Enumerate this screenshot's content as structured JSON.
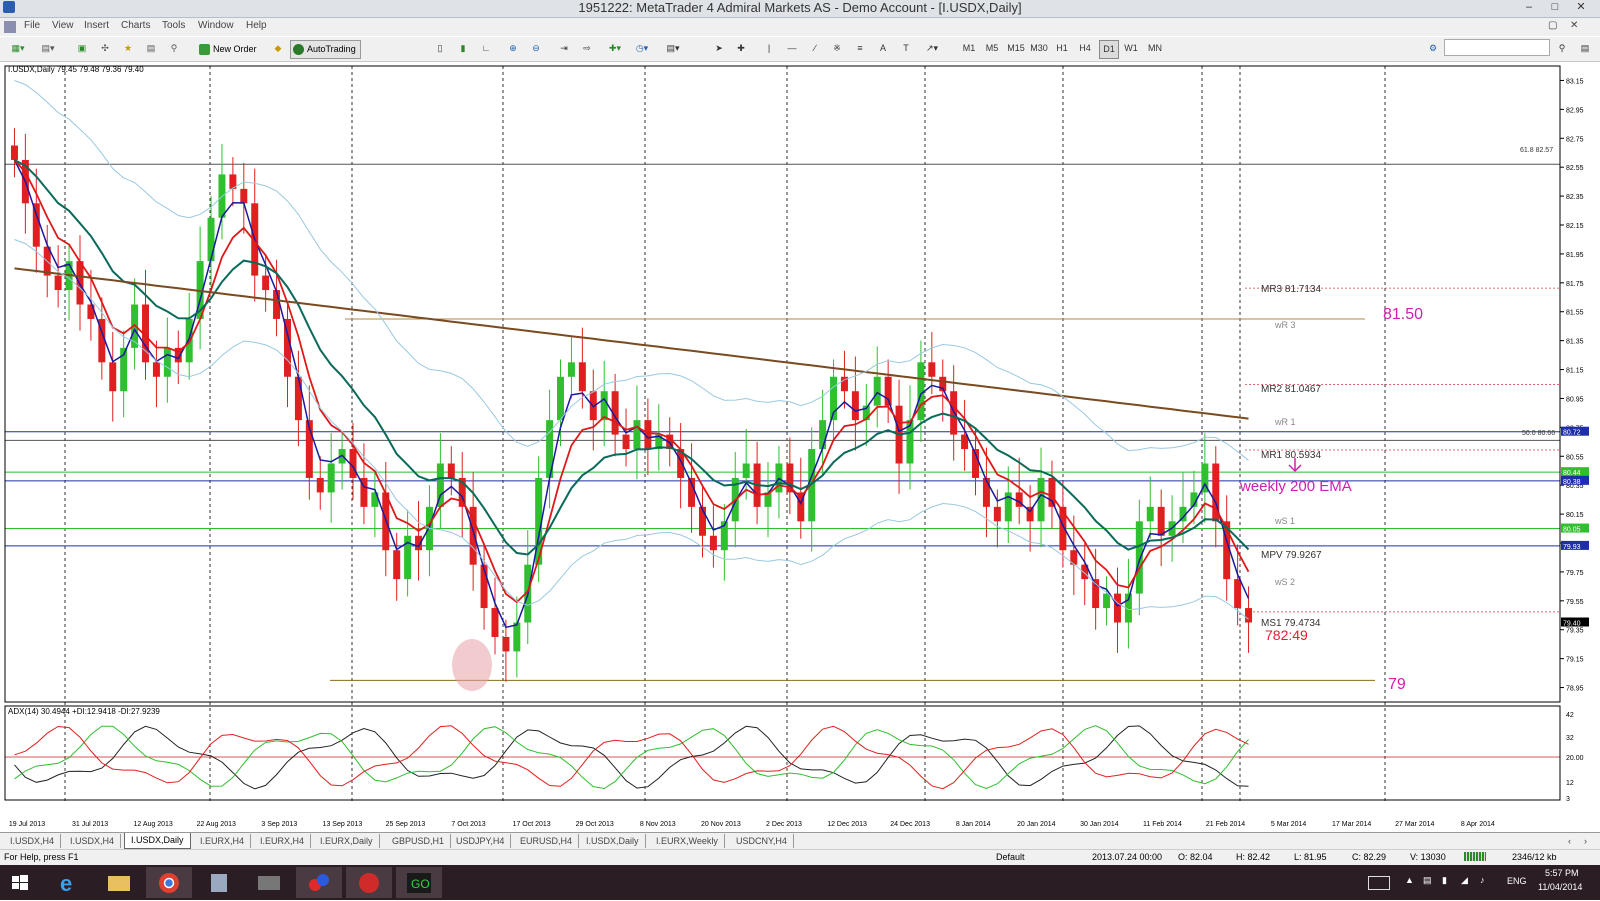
{
  "window": {
    "title": "1951222: MetaTrader 4 Admiral Markets AS - Demo Account - [I.USDX,Daily]"
  },
  "menu": [
    "File",
    "View",
    "Insert",
    "Charts",
    "Tools",
    "Window",
    "Help"
  ],
  "toolbar": {
    "new_order_label": "New Order",
    "autotrading_label": "AutoTrading",
    "timeframes": [
      "M1",
      "M5",
      "M15",
      "M30",
      "H1",
      "H4",
      "D1",
      "W1",
      "MN"
    ],
    "active_timeframe": "D1"
  },
  "chart": {
    "symbol_header": "I.USDX,Daily  79.45 79.48 79.36 79.40",
    "price_labels": [
      "83.15",
      "82.95",
      "82.75",
      "82.55",
      "82.35",
      "82.15",
      "81.95",
      "81.75",
      "81.55",
      "81.35",
      "81.15",
      "80.95",
      "80.75",
      "80.55",
      "80.35",
      "80.15",
      "79.95",
      "79.75",
      "79.55",
      "79.35",
      "79.15",
      "78.95"
    ],
    "highlighted_prices": [
      {
        "value": "80.72",
        "color": "#1f2fa8"
      },
      {
        "value": "80.44",
        "color": "#2fbf2f"
      },
      {
        "value": "80.38",
        "color": "#1f2fa8"
      },
      {
        "value": "80.05",
        "color": "#2fbf2f"
      },
      {
        "value": "79.93",
        "color": "#1f2fa8"
      },
      {
        "value": "79.40",
        "color": "#000000"
      }
    ],
    "fib_labels": [
      "61.8  82.57",
      "50.0  80.66"
    ],
    "pivots": [
      {
        "label": "MR3  81.7134"
      },
      {
        "label": "wR 3"
      },
      {
        "label": "MR2  81.0467"
      },
      {
        "label": "wR 1"
      },
      {
        "label": "MR1  80.5934"
      },
      {
        "label": "wS 1"
      },
      {
        "label": "MPV  79.9267"
      },
      {
        "label": "wS 2"
      },
      {
        "label": "MS1  79.4734"
      }
    ],
    "annotations": {
      "level_high": "81.50",
      "ema_note": "weekly 200 EMA",
      "countdown": "782:49",
      "level_low": "79"
    },
    "adx_header": "ADX(14) 30.4944 +DI:12.9418 -DI:27.9239",
    "adx_labels": [
      "42",
      "32",
      "20.00",
      "12",
      "3"
    ],
    "date_labels": [
      "19 Jul 2013",
      "31 Jul 2013",
      "12 Aug 2013",
      "22 Aug 2013",
      "3 Sep 2013",
      "13 Sep 2013",
      "25 Sep 2013",
      "7 Oct 2013",
      "17 Oct 2013",
      "29 Oct 2013",
      "8 Nov 2013",
      "20 Nov 2013",
      "2 Dec 2013",
      "12 Dec 2013",
      "24 Dec 2013",
      "8 Jan 2014",
      "20 Jan 2014",
      "30 Jan 2014",
      "11 Feb 2014",
      "21 Feb 2014",
      "5 Mar 2014",
      "17 Mar 2014",
      "27 Mar 2014",
      "8 Apr 2014"
    ]
  },
  "chart_data": {
    "type": "candlestick",
    "title": "I.USDX,Daily",
    "ylim": [
      78.85,
      83.25
    ],
    "close_series": [
      82.6,
      82.3,
      82.0,
      81.8,
      81.7,
      81.9,
      81.6,
      81.5,
      81.2,
      81.0,
      81.3,
      81.6,
      81.2,
      81.1,
      81.3,
      81.2,
      81.5,
      81.9,
      82.2,
      82.5,
      82.4,
      82.3,
      81.8,
      81.7,
      81.5,
      81.1,
      80.8,
      80.4,
      80.3,
      80.5,
      80.6,
      80.4,
      80.2,
      80.3,
      79.9,
      79.7,
      80.0,
      79.9,
      80.2,
      80.5,
      80.4,
      80.2,
      79.8,
      79.5,
      79.3,
      79.2,
      79.4,
      79.8,
      80.4,
      80.8,
      81.1,
      81.2,
      81.0,
      80.8,
      81.0,
      80.7,
      80.6,
      80.8,
      80.6,
      80.7,
      80.6,
      80.4,
      80.2,
      80.0,
      79.9,
      80.1,
      80.4,
      80.5,
      80.2,
      80.3,
      80.5,
      80.3,
      80.1,
      80.6,
      80.8,
      81.1,
      81.0,
      80.8,
      80.9,
      81.1,
      80.9,
      80.5,
      80.8,
      81.2,
      81.1,
      81.0,
      80.7,
      80.6,
      80.4,
      80.2,
      80.1,
      80.3,
      80.2,
      80.1,
      80.4,
      80.2,
      79.9,
      79.8,
      79.7,
      79.5,
      79.6,
      79.4,
      79.6,
      80.1,
      80.2,
      80.0,
      80.1,
      80.2,
      80.3,
      80.5,
      80.1,
      79.7,
      79.5,
      79.4
    ],
    "ema_200_weekly_note": "weekly 200 EMA",
    "levels": [
      81.5,
      79.0
    ],
    "adx": {
      "adx": 30.4944,
      "plus_di": 12.9418,
      "minus_di": 27.9239
    }
  },
  "tabs": [
    "I.USDX,H4",
    "I.USDX,H4",
    "I.USDX,Daily",
    "I.EURX,H4",
    "I.EURX,H4",
    "I.EURX,Daily",
    "GBPUSD,H1",
    "USDJPY,H4",
    "EURUSD,H4",
    "I.USDX,Daily",
    "I.EURX,Weekly",
    "USDCNY,H4"
  ],
  "active_tab": 2,
  "status": {
    "help": "For Help, press F1",
    "profile": "Default",
    "datetime": "2013.07.24 00:00",
    "open": "O: 82.04",
    "high": "H: 82.42",
    "low": "L: 81.95",
    "close": "C: 82.29",
    "volume": "V: 13030",
    "traffic": "2346/12 kb"
  },
  "taskbar": {
    "lang": "ENG",
    "time": "5:57 PM",
    "date": "11/04/2014"
  }
}
